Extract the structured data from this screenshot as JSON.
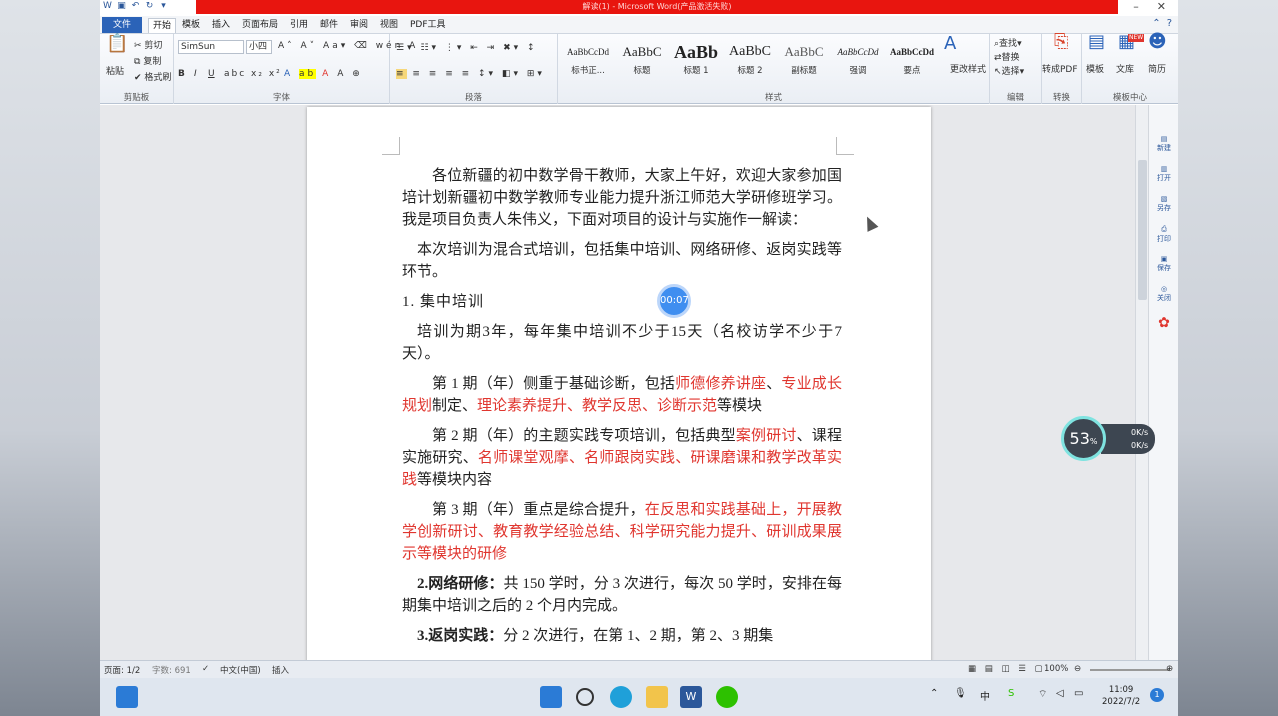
{
  "window": {
    "title": "解读(1) - Microsoft Word(产品激活失败)"
  },
  "tabs": [
    "文件",
    "开始",
    "模板",
    "插入",
    "页面布局",
    "引用",
    "邮件",
    "审阅",
    "视图",
    "PDF工具"
  ],
  "ribbon": {
    "clipboard": {
      "paste": "粘贴",
      "cut": "剪切",
      "copy": "复制",
      "format_painter": "格式刷",
      "label": "剪贴板"
    },
    "font": {
      "name": "SimSun",
      "size": "小四",
      "label": "字体"
    },
    "paragraph": {
      "label": "段落"
    },
    "styles": {
      "items": [
        {
          "preview": "AaBbCcDd",
          "name": "标书正..."
        },
        {
          "preview": "AaBbC",
          "name": "标题"
        },
        {
          "preview": "AaBb",
          "name": "标题 1"
        },
        {
          "preview": "AaBbC",
          "name": "标题 2"
        },
        {
          "preview": "AaBbC",
          "name": "副标题"
        },
        {
          "preview": "AaBbCcDd",
          "name": "强调"
        },
        {
          "preview": "AaBbCcDd",
          "name": "要点"
        }
      ],
      "change_styles": "更改样式",
      "label": "样式"
    },
    "editing": {
      "find": "查找",
      "replace": "替换",
      "select": "选择",
      "label": "编辑"
    },
    "convert": {
      "to_pdf": "转成PDF",
      "label": "转换"
    },
    "template_center": {
      "template": "模板",
      "library": "文库",
      "resume": "简历",
      "label": "模板中心",
      "new_badge": "NEW"
    }
  },
  "document": {
    "paragraphs": [
      "各位新疆的初中数学骨干教师，大家上午好，欢迎大家参加国培计划新疆初中数学教师专业能力提升浙江师范大学研修班学习。我是项目负责人朱伟义，下面对项目的设计与实施作一解读：",
      "本次培训为混合式培训，包括集中培训、网络研修、返岗实践等环节。",
      "1. 集中培训",
      "培训为期3年，每年集中培训不少于15天（名校访学不少于7天）。",
      "3 期（年）重点是综合提升，"
    ],
    "p5": {
      "a": "第 1 期（年）侧重于基础诊断，包括",
      "r1": "师德修养讲座",
      "b": "、",
      "r2": "专业成长规划",
      "c": "制定、",
      "r3": "理论素养提升、教学反思、诊断示范",
      "d": "等模块"
    },
    "p6": {
      "a": "第 2 期（年）的主题实践专项培训，包括典型",
      "r1": "案例研讨",
      "b": "、课程实施研究、",
      "r2": "名师课堂观摩、名师跟岗实践、研课磨课和教学改革实践",
      "c": "等模块内容"
    },
    "p7": {
      "a": "第 3 期（年）重点是综合提升，",
      "r1": "在反思和实践基础上，开展教学创新研讨、教育教学经验总结、科学研究能力提升、研训成果展示等模块的研修"
    },
    "p8": {
      "bold": "2.网络研修：",
      "text": "共 150 学时，分 3 次进行，每次 50 学时，安排在每期集中培训之后的 2 个月内完成。"
    },
    "p9": {
      "bold": "3.返岗实践：",
      "text": "分 2 次进行，在第 1、2 期，第 2、3 期集"
    }
  },
  "overlay": {
    "timer": "00:07",
    "cpu": "53",
    "cpu_unit": "%",
    "up": "0",
    "down": "0",
    "speed_unit": "K/s"
  },
  "status": {
    "page": "页面: 1/2",
    "words": "字数: 691",
    "lang": "中文(中国)",
    "mode": "插入",
    "zoom": "100%"
  },
  "taskbar": {
    "ime": "中",
    "time": "11:09",
    "date": "2022/7/2",
    "notif": "1"
  },
  "rightpane": {
    "items": [
      "新建",
      "打开",
      "另存",
      "打印",
      "保存",
      "关闭",
      "帮助"
    ]
  }
}
